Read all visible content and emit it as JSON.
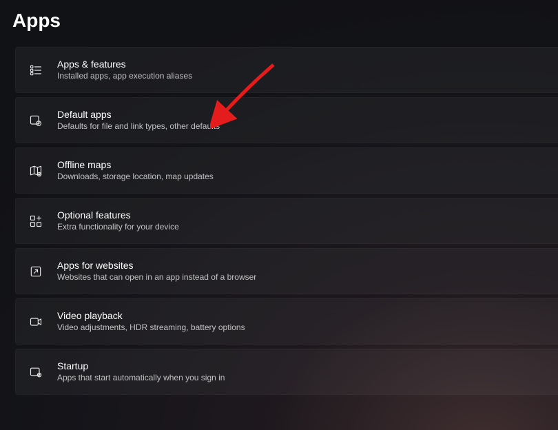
{
  "page": {
    "title": "Apps"
  },
  "items": [
    {
      "title": "Apps & features",
      "subtitle": "Installed apps, app execution aliases"
    },
    {
      "title": "Default apps",
      "subtitle": "Defaults for file and link types, other defaults"
    },
    {
      "title": "Offline maps",
      "subtitle": "Downloads, storage location, map updates"
    },
    {
      "title": "Optional features",
      "subtitle": "Extra functionality for your device"
    },
    {
      "title": "Apps for websites",
      "subtitle": "Websites that can open in an app instead of a browser"
    },
    {
      "title": "Video playback",
      "subtitle": "Video adjustments, HDR streaming, battery options"
    },
    {
      "title": "Startup",
      "subtitle": "Apps that start automatically when you sign in"
    }
  ],
  "annotation": {
    "arrow_color": "#e51c1c"
  }
}
